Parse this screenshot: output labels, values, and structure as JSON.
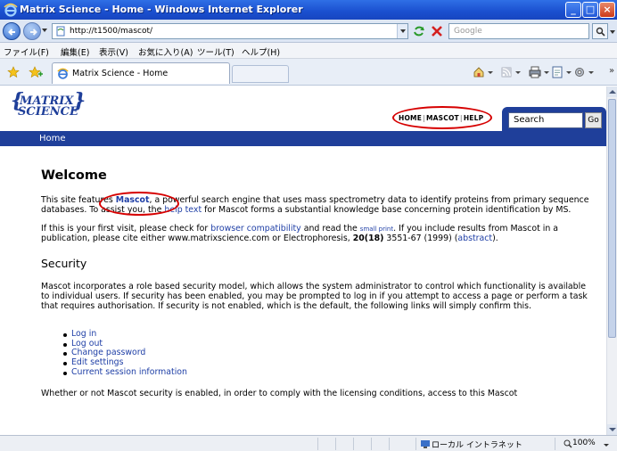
{
  "window": {
    "title": "Matrix Science - Home - Windows Internet Explorer"
  },
  "address_bar": {
    "url": "http://t1500/mascot/",
    "search_placeholder": "Google"
  },
  "menu": {
    "items": [
      "ファイル(F)",
      "編集(E)",
      "表示(V)",
      "お気に入り(A)",
      "ツール(T)",
      "ヘルプ(H)"
    ]
  },
  "tab": {
    "label": "Matrix Science - Home"
  },
  "site": {
    "logo_line1": "MATRIX",
    "logo_line2": "SCIENCE",
    "nav": {
      "home": "HOME",
      "mascot": "MASCOT",
      "help": "HELP",
      "separator": "|"
    },
    "search_value": "Search",
    "go_label": "Go",
    "breadcrumb_home": "Home",
    "brand_color": "#1f3f9a",
    "highlight_color": "#d60000"
  },
  "content": {
    "welcome_heading": "Welcome",
    "p1": {
      "a": "This site features ",
      "mascot": "Mascot",
      "b": ", a powerful search engine that uses mass spectrometry data to identify proteins from primary sequence databases. To assist you, the ",
      "help_text": "help text",
      "c": " for Mascot forms a substantial knowledge base concerning protein identification by MS."
    },
    "p2": {
      "a": "If this is your first visit, please check for ",
      "compat": "browser compatibility",
      "b": " and read the ",
      "small_print": "small print",
      "c": ". If you include results from Mascot in a publication, please cite either www.matrixscience.com or Electrophoresis, ",
      "volume": "20(18)",
      "d": " 3551-67 (1999) (",
      "abstract": "abstract",
      "e": ")."
    },
    "security_heading": "Security",
    "p3": "Mascot incorporates a role based security model, which allows the system administrator to control which functionality is available to individual users. If security has been enabled, you may be prompted to log in if you attempt to access a page or perform a task that requires authorisation. If security is not enabled, which is the default, the following links will simply confirm this.",
    "links": [
      "Log in",
      "Log out",
      "Change password",
      "Edit settings",
      "Current session information"
    ],
    "p4": "Whether or not Mascot security is enabled, in order to comply with the licensing conditions, access to this Mascot"
  },
  "status_bar": {
    "zone": "ローカル イントラネット",
    "zoom": "100%"
  }
}
